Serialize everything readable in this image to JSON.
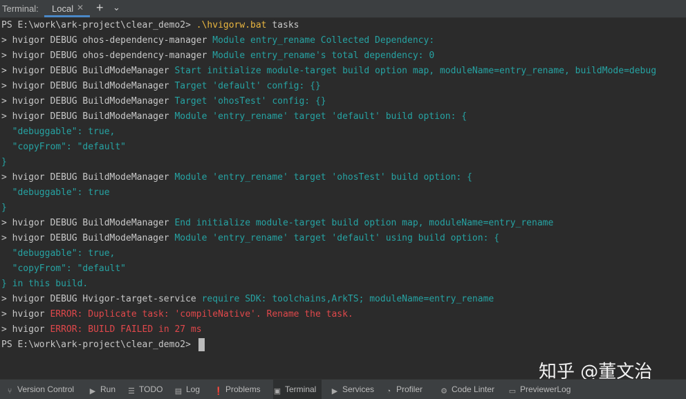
{
  "toolbar": {
    "title": "Terminal:",
    "tab_label": "Local",
    "tab_close": "✕",
    "new_tab": "+",
    "dropdown": "⌄"
  },
  "terminal": {
    "lines": [
      [
        [
          "w",
          "PS E:\\work\\ark-project\\clear_demo2> "
        ],
        [
          "b",
          ".\\hvigorw.bat"
        ],
        [
          "w",
          " tasks"
        ]
      ],
      [
        [
          "w",
          "> hvigor DEBUG ohos-dependency-manager "
        ],
        [
          "t",
          "Module entry_rename Collected Dependency:"
        ]
      ],
      [
        [
          "w",
          "> hvigor DEBUG ohos-dependency-manager "
        ],
        [
          "t",
          "Module entry_rename's total dependency: 0"
        ]
      ],
      [
        [
          "w",
          "> hvigor DEBUG BuildModeManager "
        ],
        [
          "t",
          "Start initialize module-target build option map, moduleName=entry_rename, buildMode=debug"
        ]
      ],
      [
        [
          "w",
          "> hvigor DEBUG BuildModeManager "
        ],
        [
          "t",
          "Target 'default' config: {}"
        ]
      ],
      [
        [
          "w",
          "> hvigor DEBUG BuildModeManager "
        ],
        [
          "t",
          "Target 'ohosTest' config: {}"
        ]
      ],
      [
        [
          "w",
          "> hvigor DEBUG BuildModeManager "
        ],
        [
          "t",
          "Module 'entry_rename' target 'default' build option: {"
        ]
      ],
      [
        [
          "t",
          "  \"debuggable\": true,"
        ]
      ],
      [
        [
          "t",
          "  \"copyFrom\": \"default\""
        ]
      ],
      [
        [
          "t",
          "}"
        ]
      ],
      [
        [
          "w",
          "> hvigor DEBUG BuildModeManager "
        ],
        [
          "t",
          "Module 'entry_rename' target 'ohosTest' build option: {"
        ]
      ],
      [
        [
          "t",
          "  \"debuggable\": true"
        ]
      ],
      [
        [
          "t",
          "}"
        ]
      ],
      [
        [
          "w",
          "> hvigor DEBUG BuildModeManager "
        ],
        [
          "t",
          "End initialize module-target build option map, moduleName=entry_rename"
        ]
      ],
      [
        [
          "w",
          "> hvigor DEBUG BuildModeManager "
        ],
        [
          "t",
          "Module 'entry_rename' target 'default' using build option: {"
        ]
      ],
      [
        [
          "t",
          "  \"debuggable\": true,"
        ]
      ],
      [
        [
          "t",
          "  \"copyFrom\": \"default\""
        ]
      ],
      [
        [
          "t",
          "} in this build."
        ]
      ],
      [
        [
          "w",
          "> hvigor DEBUG Hvigor-target-service "
        ],
        [
          "t",
          "require SDK: toolchains,ArkTS; moduleName=entry_rename"
        ]
      ],
      [
        [
          "w",
          "> hvigor "
        ],
        [
          "e",
          "ERROR: Duplicate task: 'compileNative'. Rename the task."
        ]
      ],
      [
        [
          "w",
          "> hvigor "
        ],
        [
          "e",
          "ERROR: BUILD FAILED in 27 ms"
        ]
      ],
      [
        [
          "w",
          "PS E:\\work\\ark-project\\clear_demo2> "
        ]
      ]
    ],
    "colors": {
      "w": "#c8c8c8",
      "t": "#26a3a3",
      "e": "#e0484b",
      "b": "#e9b640"
    }
  },
  "watermark": "知乎 @董文治",
  "statusbar": {
    "items": [
      {
        "name": "version-control",
        "icon": "version-control-icon",
        "glyph": "⑂",
        "label": "Version Control"
      },
      {
        "name": "run",
        "icon": "run-icon",
        "glyph": "▶",
        "label": "Run"
      },
      {
        "name": "todo",
        "icon": "todo-icon",
        "glyph": "☰",
        "label": "TODO"
      },
      {
        "name": "log",
        "icon": "log-icon",
        "glyph": "▤",
        "label": "Log"
      },
      {
        "name": "problems",
        "icon": "problems-icon",
        "glyph": "❗",
        "label": "Problems"
      },
      {
        "name": "terminal",
        "icon": "terminal-icon",
        "glyph": "▣",
        "label": "Terminal",
        "active": true
      },
      {
        "name": "services",
        "icon": "services-icon",
        "glyph": "▶",
        "label": "Services"
      },
      {
        "name": "profiler",
        "icon": "profiler-icon",
        "glyph": "◔",
        "label": "Profiler"
      },
      {
        "name": "code-linter",
        "icon": "code-linter-icon",
        "glyph": "⚙",
        "label": "Code Linter"
      },
      {
        "name": "previewer-log",
        "icon": "previewer-log-icon",
        "glyph": "▭",
        "label": "PreviewerLog"
      }
    ]
  }
}
